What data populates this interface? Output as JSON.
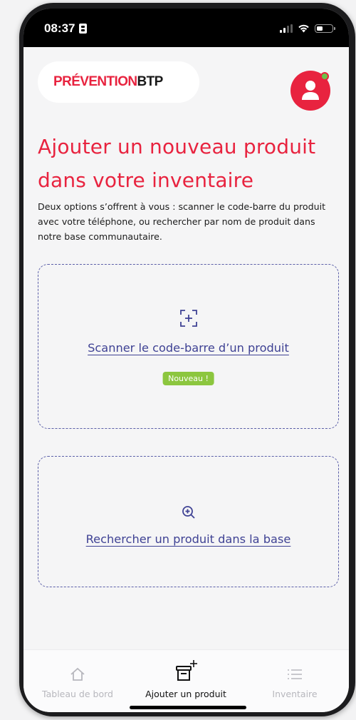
{
  "status_bar": {
    "time": "08:37",
    "icons": [
      "sim-card-icon",
      "cellular-signal-icon",
      "wifi-icon",
      "battery-icon"
    ]
  },
  "header": {
    "logo_part1": "PRÉVENTION",
    "logo_part2": "BTP",
    "avatar_icon": "user-icon",
    "online_indicator_color": "#6cc24a"
  },
  "page": {
    "title": "Ajouter un nouveau produit dans votre inventaire",
    "description": "Deux options s’offrent à vous : scanner le code-barre du produit avec votre téléphone, ou rechercher par nom de produit dans notre base communautaire."
  },
  "options": {
    "scan": {
      "icon": "barcode-scan-icon",
      "label": "Scanner le code-barre d’un produit",
      "badge": "Nouveau !"
    },
    "search": {
      "icon": "zoom-in-icon",
      "label": "Rechercher un produit dans la base"
    }
  },
  "tabbar": {
    "dashboard": {
      "label": "Tableau de bord",
      "icon": "home-icon"
    },
    "add_product": {
      "label": "Ajouter un produit",
      "icon": "add-box-icon",
      "active": true
    },
    "inventory": {
      "label": "Inventaire",
      "icon": "list-icon"
    }
  },
  "colors": {
    "brand_red": "#e8233f",
    "link_blue": "#3f4294",
    "badge_green": "#8cc63f",
    "inactive_gray": "#b7b7bd"
  }
}
